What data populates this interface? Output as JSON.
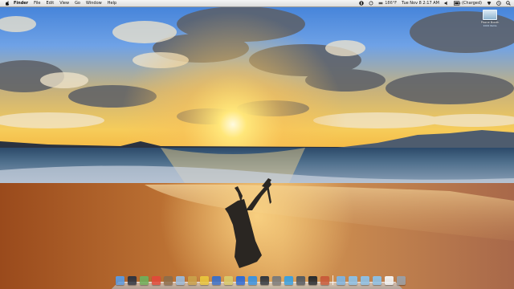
{
  "menubar": {
    "app_name": "Finder",
    "menus": [
      "File",
      "Edit",
      "View",
      "Go",
      "Window",
      "Help"
    ],
    "status": {
      "temperature": "186°F",
      "datetime": "Tue Nov 8  2:17 AM",
      "battery": "(Charged)"
    }
  },
  "desktop": {
    "icon_label": "Phone Booth",
    "icon_sublabel": "1024 items"
  },
  "dock": {
    "apps": [
      {
        "name": "finder",
        "color": "#5b9ae0"
      },
      {
        "name": "dashboard",
        "color": "#2e3440"
      },
      {
        "name": "mail",
        "color": "#6fae5a"
      },
      {
        "name": "ical",
        "color": "#e04a3a"
      },
      {
        "name": "addressbook",
        "color": "#8e6d4a"
      },
      {
        "name": "preview",
        "color": "#9ab8d8"
      },
      {
        "name": "photos",
        "color": "#c9a04a"
      },
      {
        "name": "chrome",
        "color": "#e8c43c"
      },
      {
        "name": "itunes",
        "color": "#3a6fc8"
      },
      {
        "name": "notes",
        "color": "#d8c86a"
      },
      {
        "name": "appstore",
        "color": "#2d6ad6"
      },
      {
        "name": "safari",
        "color": "#3a92e0"
      },
      {
        "name": "steam",
        "color": "#30363e"
      },
      {
        "name": "sysprefs",
        "color": "#7a7a7a"
      },
      {
        "name": "skype",
        "color": "#3aa0e0"
      },
      {
        "name": "photobooth",
        "color": "#555a60"
      },
      {
        "name": "terminal",
        "color": "#262a2e"
      },
      {
        "name": "activity",
        "color": "#c85a3a"
      }
    ],
    "folders": [
      {
        "name": "applications-folder",
        "color": "#7fb4e0"
      },
      {
        "name": "documents-folder",
        "color": "#8cc0e6"
      },
      {
        "name": "downloads-folder",
        "color": "#8cc0e6"
      },
      {
        "name": "pictures-folder",
        "color": "#8cc0e6"
      },
      {
        "name": "document-stack",
        "color": "#f2f2f2"
      },
      {
        "name": "trash",
        "color": "#9aa0a6"
      }
    ]
  }
}
